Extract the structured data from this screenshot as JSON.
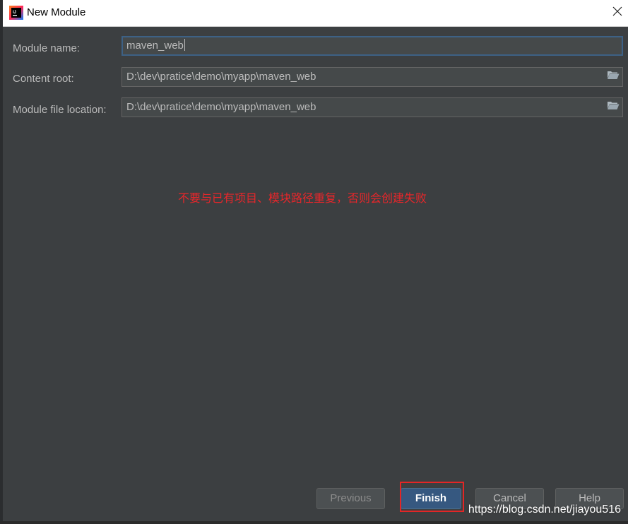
{
  "window": {
    "title": "New Module",
    "icons": {
      "app": "intellij-icon",
      "close": "close-icon"
    }
  },
  "form": {
    "module_name": {
      "label": "Module name:",
      "value": "maven_web"
    },
    "content_root": {
      "label": "Content root:",
      "value": "D:\\dev\\pratice\\demo\\myapp\\maven_web",
      "icon": "folder-open-icon"
    },
    "module_file_location": {
      "label": "Module file location:",
      "value": "D:\\dev\\pratice\\demo\\myapp\\maven_web",
      "icon": "folder-open-icon"
    }
  },
  "annotation": "不要与已有项目、模块路径重复，否则会创建失败",
  "buttons": {
    "previous": "Previous",
    "finish": "Finish",
    "cancel": "Cancel",
    "help": "Help"
  },
  "watermark": "https://blog.csdn.net/jiayou516",
  "colors": {
    "background": "#3c3f41",
    "field_bg": "#45494a",
    "text": "#bbbbbb",
    "primary_button": "#365880",
    "annotation_red": "#e8262a"
  }
}
